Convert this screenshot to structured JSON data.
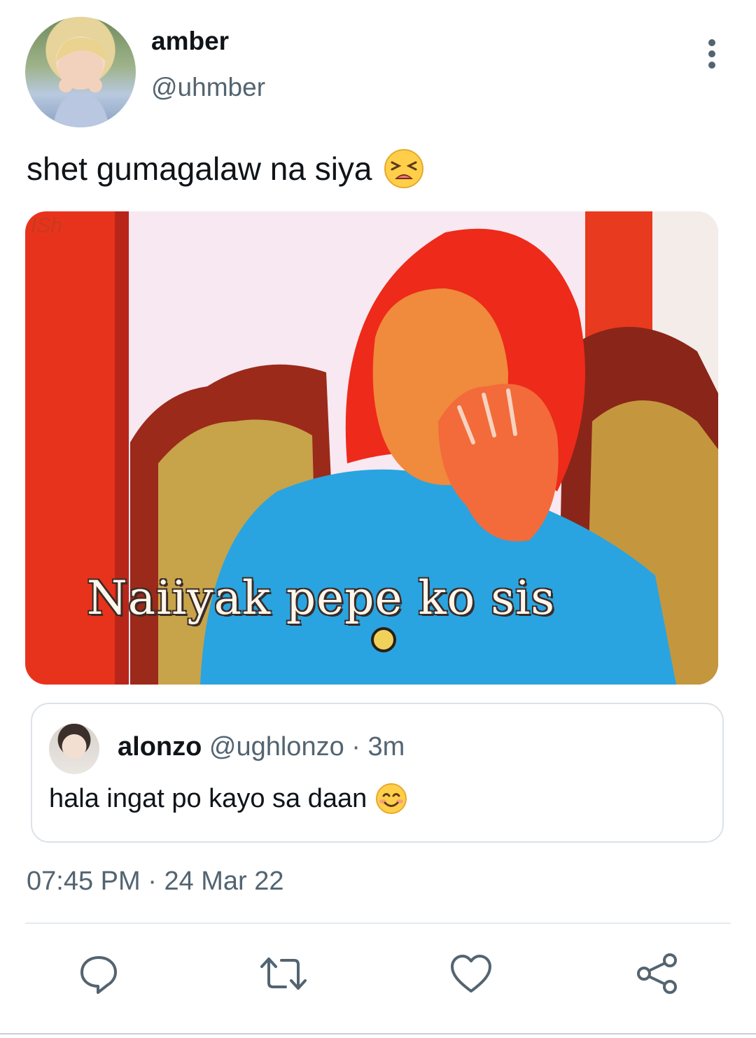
{
  "tweet": {
    "author": {
      "display_name": "amber",
      "handle": "@uhmber"
    },
    "text": "shet gumagalaw na siya",
    "text_emoji": "tired-face-emoji",
    "media": {
      "watermark": "ISh",
      "caption": "Naiiyak pepe ko sis"
    },
    "quoted": {
      "display_name": "alonzo",
      "handle": "@ughlonzo",
      "separator": "·",
      "time": "3m",
      "text": "hala ingat po kayo sa daan",
      "text_emoji": "smiling-face-emoji"
    },
    "time": "07:45 PM",
    "date_separator": "·",
    "date": "24 Mar 22"
  },
  "actions": [
    "reply-icon",
    "retweet-icon",
    "like-icon",
    "share-icon"
  ],
  "colors": {
    "secondary_text": "#536471",
    "icon": "#536471",
    "border": "#dbe2e8"
  }
}
